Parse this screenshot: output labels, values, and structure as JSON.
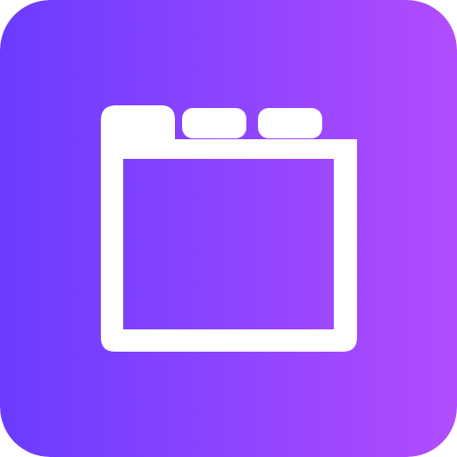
{
  "icon": {
    "name": "tabbed-window-icon",
    "description_visible": "",
    "colors": {
      "gradient_start": "#6a3cff",
      "gradient_end": "#b24cff",
      "glyph": "#ffffff"
    }
  }
}
